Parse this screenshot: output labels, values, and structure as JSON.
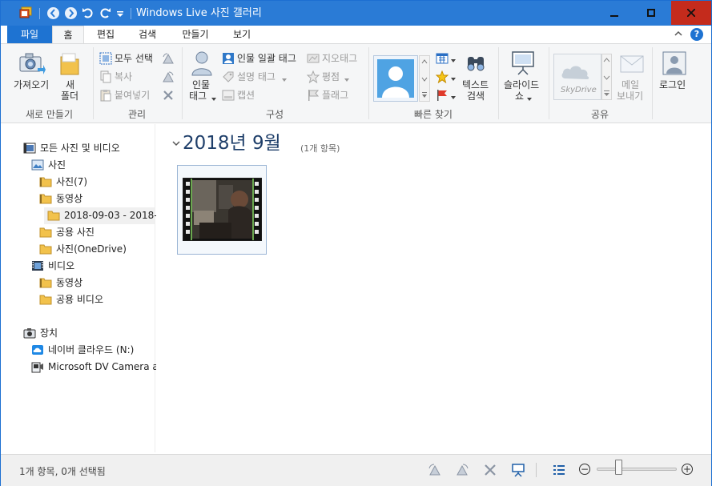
{
  "window": {
    "title": "Windows Live 사진 갤러리"
  },
  "ribbon_tabs": [
    {
      "label": "파일"
    },
    {
      "label": "홈"
    },
    {
      "label": "편집"
    },
    {
      "label": "검색"
    },
    {
      "label": "만들기"
    },
    {
      "label": "보기"
    }
  ],
  "ribbon": {
    "import": {
      "label": "가져오기"
    },
    "new_folder": {
      "label_1": "새",
      "label_2": "폴더"
    },
    "group_new": "새로 만들기",
    "select_all": "모두 선택",
    "copy": "복사",
    "paste": "붙여넣기",
    "group_manage": "관리",
    "people_tag": {
      "label_1": "인물",
      "label_2": "태그"
    },
    "batch_people_tag": "인물 일괄 태그",
    "geotag": "지오태그",
    "description_tag": "설명 태그",
    "rating": "평점",
    "caption": "캡션",
    "flag": "플래그",
    "group_organize": "구성",
    "text_search": {
      "label_1": "텍스트",
      "label_2": "검색"
    },
    "group_quickfind": "빠른 찾기",
    "slideshow": {
      "label_1": "슬라이드",
      "label_2": "쇼"
    },
    "skydrive": "SkyDrive",
    "email": {
      "label_1": "메일",
      "label_2": "보내기"
    },
    "group_share": "공유",
    "login": "로그인"
  },
  "nav": {
    "items": [
      {
        "label": "모든 사진 및 비디오",
        "icon": "gallery-icon"
      },
      {
        "label": "사진",
        "icon": "pictures-library-icon"
      },
      {
        "label": "사진(7)",
        "icon": "folder-pictures-icon"
      },
      {
        "label": "동영상",
        "icon": "folder-video-icon"
      },
      {
        "label": "2018-09-03 - 2018-",
        "icon": "folder-icon"
      },
      {
        "label": "공용 사진",
        "icon": "folder-icon"
      },
      {
        "label": "사진(OneDrive)",
        "icon": "folder-icon"
      },
      {
        "label": "비디오",
        "icon": "video-library-icon"
      },
      {
        "label": "동영상",
        "icon": "folder-video-icon"
      },
      {
        "label": "공용 비디오",
        "icon": "folder-icon"
      },
      {
        "label": "장치",
        "icon": "camera-icon"
      },
      {
        "label": "네이버 클라우드 (N:)",
        "icon": "cloud-drive-icon"
      },
      {
        "label": "Microsoft DV Camera ar",
        "icon": "dv-camera-icon"
      }
    ]
  },
  "main": {
    "group_title": "2018년 9월",
    "group_count": "(1개 항목)"
  },
  "status": {
    "text": "1개 항목, 0개 선택됨",
    "zoom_level": 0.25
  }
}
